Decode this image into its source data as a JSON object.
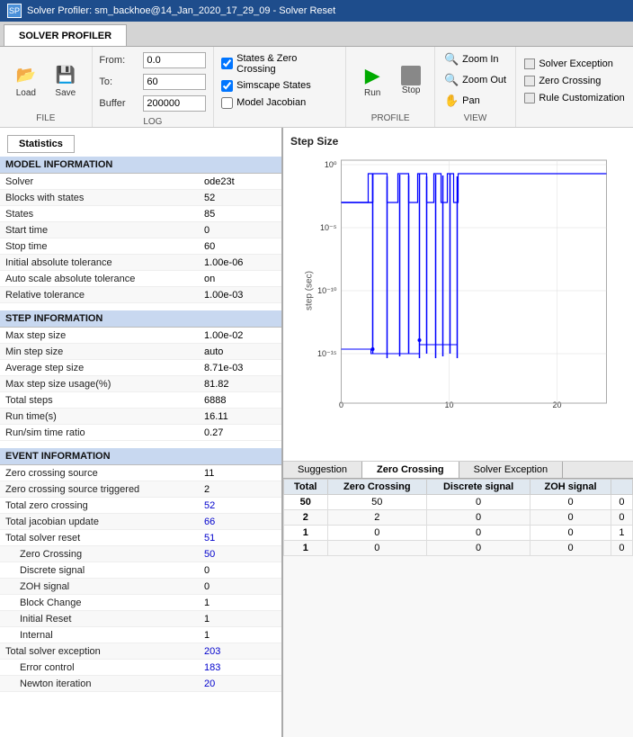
{
  "titlebar": {
    "title": "Solver Profiler: sm_backhoe@14_Jan_2020_17_29_09 - Solver Reset",
    "icon": "SP"
  },
  "tabs": [
    {
      "label": "SOLVER PROFILER",
      "active": true
    }
  ],
  "toolbar": {
    "log": {
      "label": "LOG",
      "from_label": "From:",
      "from_value": "0.0",
      "to_label": "To:",
      "to_value": "60",
      "buffer_label": "Buffer",
      "buffer_value": "200000"
    },
    "checkboxes": {
      "states_zero_crossing": {
        "label": "States & Zero Crossing",
        "checked": true
      },
      "simscape_states": {
        "label": "Simscape States",
        "checked": true
      },
      "model_jacobian": {
        "label": "Model Jacobian",
        "checked": false
      }
    },
    "profile": {
      "label": "PROFILE",
      "run_label": "Run",
      "stop_label": "Stop"
    },
    "view": {
      "label": "VIEW",
      "zoom_in": "Zoom In",
      "zoom_out": "Zoom Out",
      "pan": "Pan"
    },
    "f_section": {
      "solver_exception": "Solver Exception",
      "zero_crossing": "Zero Crossing",
      "rule_customization": "Rule Customization"
    }
  },
  "section_labels": {
    "file": "FILE",
    "log": "LOG",
    "profile": "PROFILE",
    "view": "VIEW"
  },
  "statistics_tab": {
    "label": "Statistics"
  },
  "model_info": {
    "header": "MODEL INFORMATION",
    "rows": [
      {
        "label": "Solver",
        "value": "ode23t",
        "color": "black"
      },
      {
        "label": "Blocks with states",
        "value": "52",
        "color": "black"
      },
      {
        "label": "States",
        "value": "85",
        "color": "black"
      },
      {
        "label": "Start time",
        "value": "0",
        "color": "black"
      },
      {
        "label": "Stop time",
        "value": "60",
        "color": "black"
      },
      {
        "label": "Initial absolute tolerance",
        "value": "1.00e-06",
        "color": "black"
      },
      {
        "label": "Auto scale absolute tolerance",
        "value": "on",
        "color": "black"
      },
      {
        "label": "Relative tolerance",
        "value": "1.00e-03",
        "color": "black"
      }
    ]
  },
  "step_info": {
    "header": "STEP INFORMATION",
    "rows": [
      {
        "label": "Max step size",
        "value": "1.00e-02",
        "color": "black"
      },
      {
        "label": "Min step size",
        "value": "auto",
        "color": "black"
      },
      {
        "label": "Average step size",
        "value": "8.71e-03",
        "color": "black"
      },
      {
        "label": "Max step size usage(%)",
        "value": "81.82",
        "color": "black"
      },
      {
        "label": "Total steps",
        "value": "6888",
        "color": "black"
      },
      {
        "label": "Run time(s)",
        "value": "16.11",
        "color": "black"
      },
      {
        "label": "Run/sim time ratio",
        "value": "0.27",
        "color": "black"
      }
    ]
  },
  "event_info": {
    "header": "EVENT INFORMATION",
    "rows": [
      {
        "label": "Zero crossing source",
        "value": "11",
        "color": "black"
      },
      {
        "label": "Zero crossing source triggered",
        "value": "2",
        "color": "black"
      },
      {
        "label": "Total zero crossing",
        "value": "52",
        "color": "blue"
      },
      {
        "label": "Total jacobian update",
        "value": "66",
        "color": "blue"
      },
      {
        "label": "Total solver reset",
        "value": "51",
        "color": "blue"
      },
      {
        "label": "  Zero Crossing",
        "value": "50",
        "color": "blue",
        "indent": true
      },
      {
        "label": "  Discrete signal",
        "value": "0",
        "color": "black",
        "indent": true
      },
      {
        "label": "  ZOH signal",
        "value": "0",
        "color": "black",
        "indent": true
      },
      {
        "label": "  Block Change",
        "value": "1",
        "color": "black",
        "indent": true
      },
      {
        "label": "  Initial Reset",
        "value": "1",
        "color": "black",
        "indent": true
      },
      {
        "label": "  Internal",
        "value": "1",
        "color": "black",
        "indent": true
      },
      {
        "label": "Total solver exception",
        "value": "203",
        "color": "blue"
      },
      {
        "label": "  Error control",
        "value": "183",
        "color": "blue",
        "indent": true
      },
      {
        "label": "  Newton iteration",
        "value": "20",
        "color": "blue",
        "indent": true
      }
    ]
  },
  "chart": {
    "title": "Step Size",
    "x_label": "",
    "y_label": "step (sec)",
    "x_min": 0,
    "x_max": 20,
    "y_labels": [
      "10^0",
      "10^-5",
      "10^-10",
      "10^-15"
    ]
  },
  "bottom_tabs": [
    {
      "label": "Suggestion",
      "active": false
    },
    {
      "label": "Zero Crossing",
      "active": true
    },
    {
      "label": "Solver Exception",
      "active": false
    }
  ],
  "bottom_table": {
    "headers": [
      "Total",
      "Zero Crossing",
      "Discrete signal",
      "ZOH signal"
    ],
    "rows": [
      [
        "50",
        "50",
        "0",
        "0",
        "0"
      ],
      [
        "2",
        "2",
        "0",
        "0",
        "0"
      ],
      [
        "1",
        "0",
        "0",
        "0",
        "1"
      ],
      [
        "1",
        "0",
        "0",
        "0",
        "0"
      ]
    ]
  }
}
